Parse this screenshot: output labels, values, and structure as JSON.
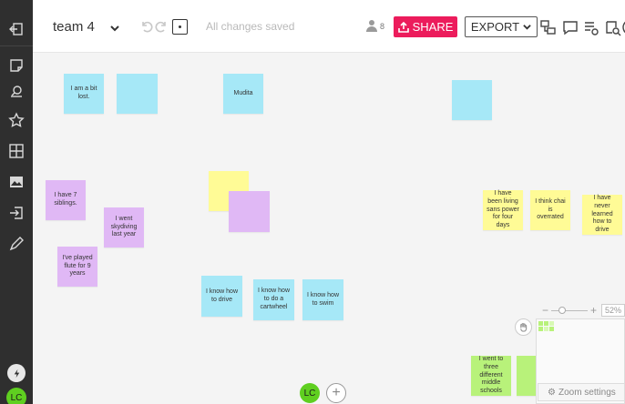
{
  "toolbar": {
    "board_title": "team 4",
    "save_status": "All changes saved",
    "user_count": "8",
    "share_label": "SHARE",
    "export_label": "EXPORT"
  },
  "sidebar": {
    "avatar_initials": "LC",
    "tools": [
      "back-icon",
      "sticky-note-icon",
      "search-icon",
      "star-icon",
      "grid-icon",
      "image-icon",
      "import-icon",
      "pen-icon"
    ]
  },
  "notes": {
    "n1": "I am a bit lost.",
    "n2": "",
    "n3": "Mudita",
    "n4": "",
    "n5": "I have 7 siblings.",
    "n6": "I went skydiving last year",
    "n7": "I've played flute for 9 years",
    "n8": "",
    "n9": "",
    "n10": "I know how to drive",
    "n11": "I know how to do a cartwheel",
    "n12": "I know how to swim",
    "n13": "I have been living sans power for four days",
    "n14": "I think chai is overrated",
    "n15": "I have never learned how to drive",
    "n16": "I went to three different middle schools",
    "n17": "",
    "n18": ""
  },
  "zoom": {
    "minus": "−",
    "plus": "+",
    "percent": "52%",
    "settings_label": "Zoom settings"
  },
  "collaborators": {
    "initials": "LC",
    "add": "+"
  },
  "colors": {
    "share": "#ec1c5c",
    "blue_note": "#a6e8f7",
    "purple_note": "#e0b8f5",
    "yellow_note": "#fffb96",
    "green_note": "#b8f27a",
    "avatar": "#5fcf20"
  }
}
